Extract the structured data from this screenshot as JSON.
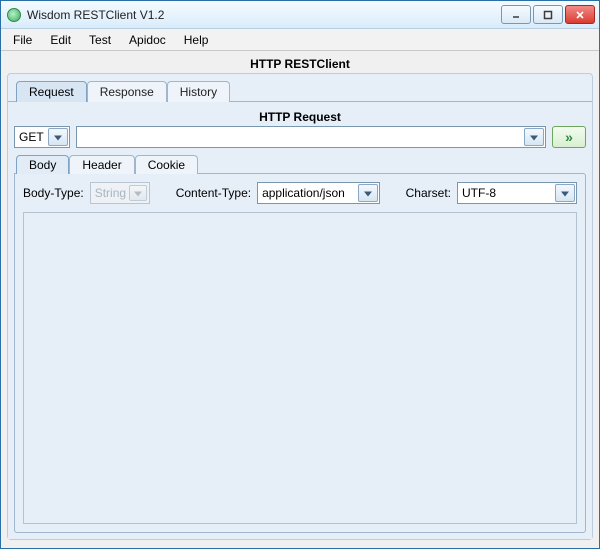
{
  "window": {
    "title": "Wisdom RESTClient V1.2",
    "minimize_tip": "Minimize",
    "maximize_tip": "Maximize",
    "close_tip": "Close"
  },
  "menu": {
    "file": "File",
    "edit": "Edit",
    "test": "Test",
    "apidoc": "Apidoc",
    "help": "Help"
  },
  "main_label": "HTTP RESTClient",
  "tabs": {
    "request": "Request",
    "response": "Response",
    "history": "History"
  },
  "request_section_label": "HTTP Request",
  "http": {
    "method": "GET",
    "url": "",
    "go_tip": "Send"
  },
  "subtabs": {
    "body": "Body",
    "header": "Header",
    "cookie": "Cookie"
  },
  "body_form": {
    "body_type_label": "Body-Type:",
    "body_type_value": "String",
    "content_type_label": "Content-Type:",
    "content_type_value": "application/json",
    "charset_label": "Charset:",
    "charset_value": "UTF-8"
  }
}
